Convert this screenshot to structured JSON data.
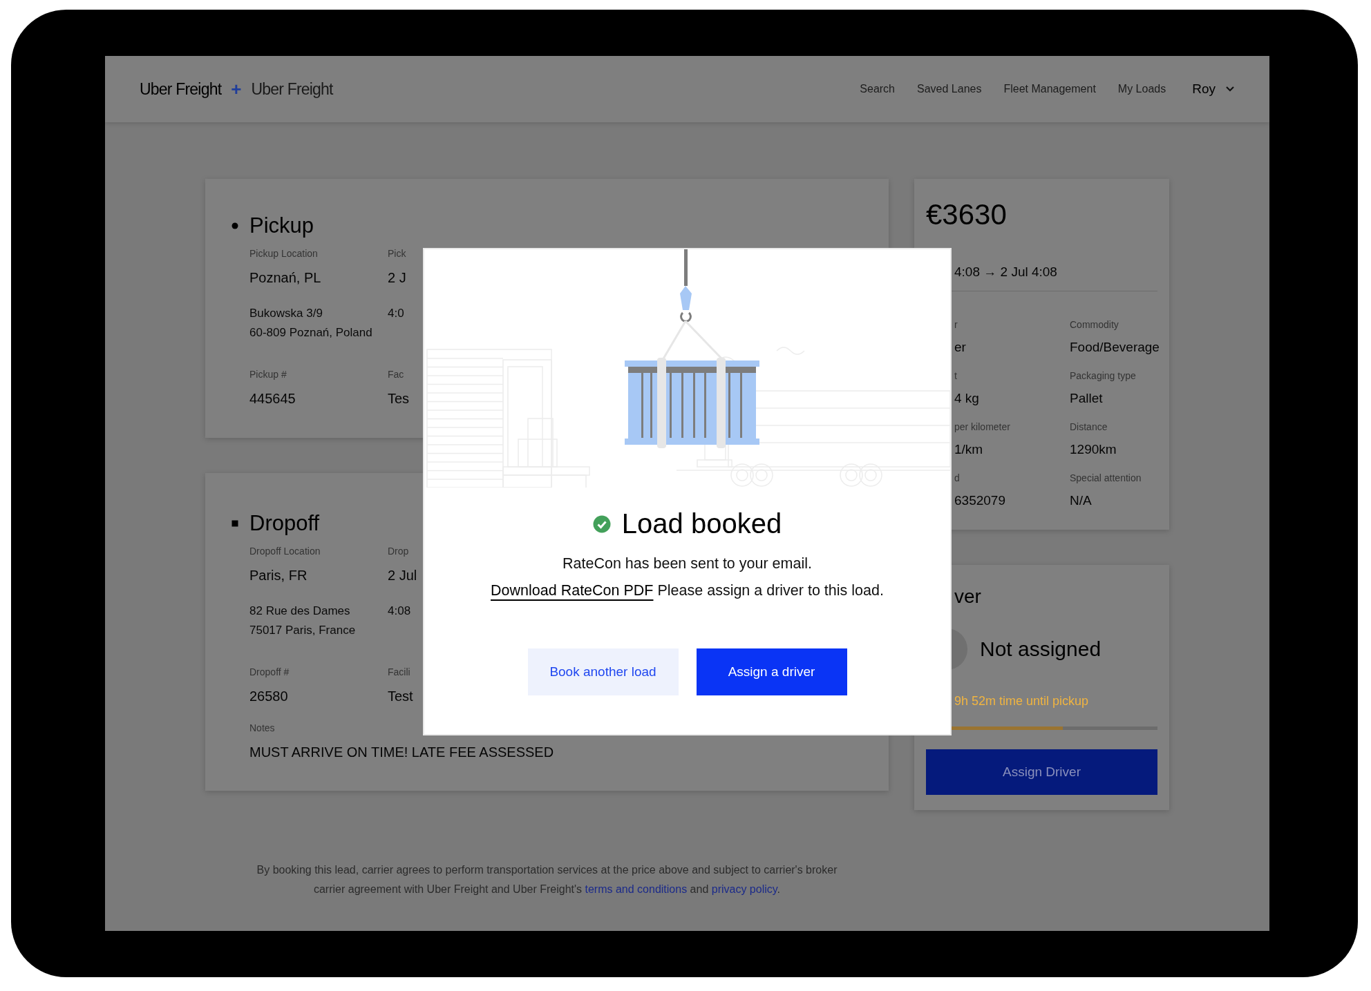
{
  "header": {
    "logo": {
      "left": "Uber Freight",
      "joiner": "+",
      "right": "Uber Freight"
    },
    "nav": [
      {
        "label": "Search"
      },
      {
        "label": "Saved Lanes"
      },
      {
        "label": "Fleet Management"
      },
      {
        "label": "My Loads"
      }
    ],
    "user": {
      "name": "Roy"
    }
  },
  "stops": [
    {
      "kind": "pickup",
      "title": "Pickup",
      "rows": [
        {
          "kind": "field",
          "cells": [
            {
              "label": "Pickup Location",
              "value": "Poznań, PL"
            },
            {
              "label": "Pick",
              "value": "2 J"
            }
          ]
        },
        {
          "kind": "address",
          "cells": [
            {
              "lines": [
                "Bukowska 3/9",
                "60-809 Poznań, Poland"
              ]
            },
            {
              "lines": [
                "4:0"
              ]
            }
          ]
        },
        {
          "kind": "field",
          "cells": [
            {
              "label": "Pickup #",
              "value": "445645"
            },
            {
              "label": "Fac",
              "value": "Tes"
            }
          ]
        }
      ]
    },
    {
      "kind": "dropoff",
      "title": "Dropoff",
      "rows": [
        {
          "kind": "field",
          "cells": [
            {
              "label": "Dropoff Location",
              "value": "Paris, FR"
            },
            {
              "label": "Drop",
              "value": "2 Jul"
            }
          ]
        },
        {
          "kind": "address",
          "cells": [
            {
              "lines": [
                "82 Rue des Dames",
                "75017 Paris, France"
              ]
            },
            {
              "lines": [
                "4:08"
              ]
            }
          ]
        },
        {
          "kind": "field",
          "cells": [
            {
              "label": "Dropoff #",
              "value": "26580"
            },
            {
              "label": "Facili",
              "value": "Test"
            }
          ]
        },
        {
          "kind": "note",
          "cells": [
            {
              "label": "Notes",
              "value": "MUST ARRIVE ON TIME! LATE FEE ASSESSED"
            }
          ]
        }
      ]
    }
  ],
  "footer": {
    "text": "By booking this lead, carrier agrees to perform transportation services at the price above and subject to carrier's broker carrier agreement with Uber Freight and Uber Freight's",
    "link_terms": "terms and conditions",
    "joiner": "and",
    "link_privacy": "privacy policy",
    "end": "."
  },
  "summary": {
    "price": "€3630",
    "dates": "4:08 → 2 Jul 4:08",
    "details": [
      {
        "label": "r",
        "value": "er"
      },
      {
        "label": "Commodity",
        "value": "Food/Beverage"
      },
      {
        "label": "t",
        "value": "4 kg"
      },
      {
        "label": "Packaging type",
        "value": "Pallet"
      },
      {
        "label": "per kilometer",
        "value": "1/km"
      },
      {
        "label": "Distance",
        "value": "1290km"
      },
      {
        "label": "d",
        "value": "6352079"
      },
      {
        "label": "Special attention",
        "value": "N/A"
      }
    ]
  },
  "driver": {
    "title": "ver",
    "status": "Not assigned",
    "countdown": "9h 52m time until pickup",
    "level": 0.59,
    "button": "Assign Driver"
  },
  "modal": {
    "title": "Load booked",
    "message": "RateCon has been sent to your email.",
    "link": "Download RateCon PDF",
    "instruction": "Please assign a driver to this load.",
    "buttons": [
      {
        "label": "Book another load",
        "kind": "secondary"
      },
      {
        "label": "Assign a driver",
        "kind": "primary"
      }
    ]
  }
}
